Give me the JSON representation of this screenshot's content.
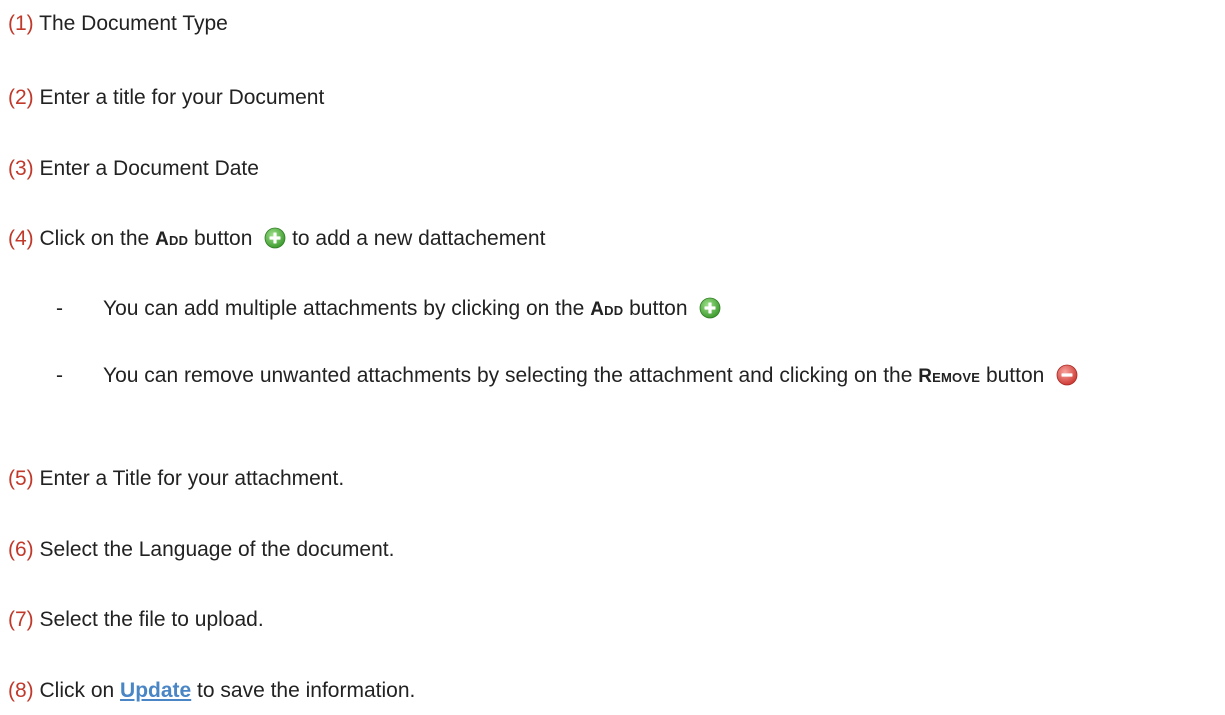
{
  "steps": [
    {
      "num": "(1)",
      "text": " The Document Type"
    },
    {
      "num": "(2)",
      "text": " Enter a title for your Document"
    },
    {
      "num": "(3)",
      "text": " Enter a Document Date"
    },
    {
      "num": "(4)",
      "text_before": " Click on the ",
      "strong": "Add",
      "text_after": " button ",
      "text_end": " to add a new dattachement"
    },
    {
      "num": "(5)",
      "text": " Enter a Title for your attachment."
    },
    {
      "num": "(6)",
      "text": " Select the Language of the document."
    },
    {
      "num": "(7)",
      "text": " Select the file to upload."
    },
    {
      "num": "(8)",
      "text_before": " Click on ",
      "link": "Update",
      "text_after": " to save the information."
    }
  ],
  "bullets": [
    {
      "dash": "-",
      "text_before": "You can add multiple attachments by clicking on the ",
      "strong": "Add",
      "text_after": " button "
    },
    {
      "dash": "-",
      "text_before": "You can remove unwanted attachments by selecting the attachment and clicking on the ",
      "strong": "Remove",
      "text_after": " button "
    }
  ],
  "icons": {
    "add": "add-circle-icon",
    "remove": "remove-circle-icon",
    "add_color": "#57b845",
    "remove_color": "#e05550",
    "number_color": "#c0392b",
    "link_color": "#4a86c5"
  }
}
